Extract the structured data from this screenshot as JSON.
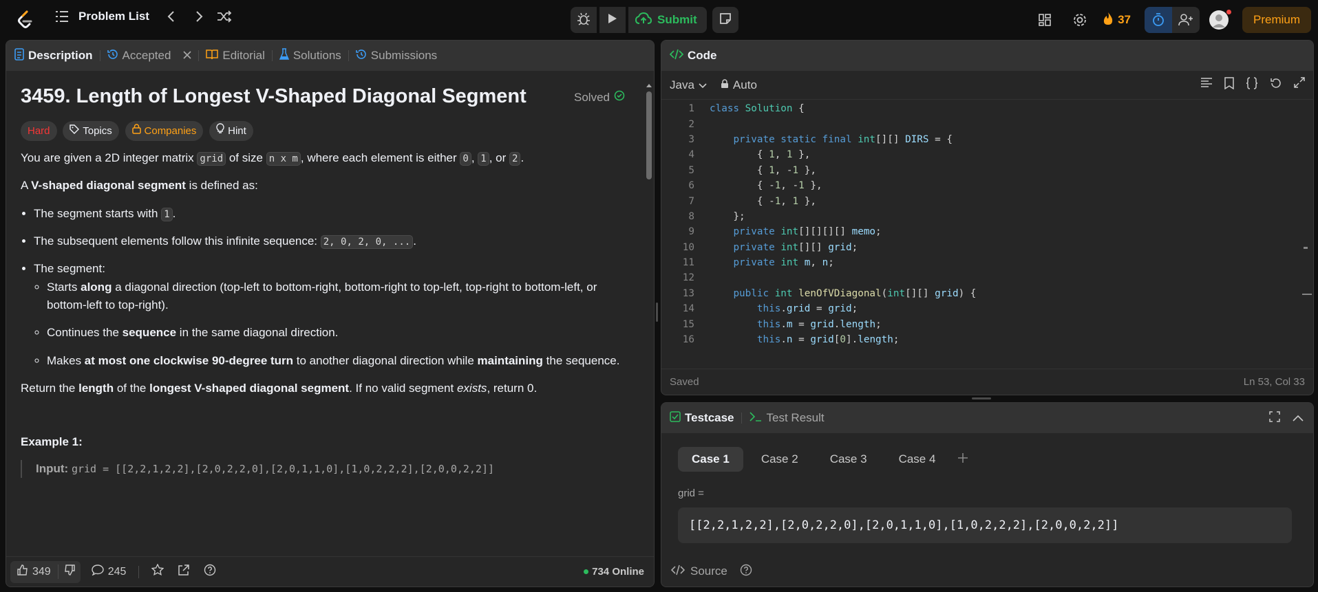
{
  "topbar": {
    "title": "Problem List",
    "submit_label": "Submit",
    "streak": "37",
    "premium_label": "Premium"
  },
  "desc_tabs": [
    {
      "label": "Description"
    },
    {
      "label": "Accepted"
    },
    {
      "label": "Editorial"
    },
    {
      "label": "Solutions"
    },
    {
      "label": "Submissions"
    }
  ],
  "problem": {
    "title": "3459. Length of Longest V-Shaped Diagonal Segment",
    "solved_label": "Solved",
    "difficulty": "Hard",
    "topics_label": "Topics",
    "companies_label": "Companies",
    "hint_label": "Hint",
    "p1_a": "You are given a 2D integer matrix ",
    "p1_code1": "grid",
    "p1_b": " of size ",
    "p1_code2": "n x m",
    "p1_c": ", where each element is either ",
    "p1_code3": "0",
    "p1_d": ", ",
    "p1_code4": "1",
    "p1_e": ", or ",
    "p1_code5": "2",
    "p1_f": ".",
    "p2_a": "A ",
    "p2_b": "V-shaped diagonal segment",
    "p2_c": " is defined as:",
    "li1_a": "The segment starts with ",
    "li1_code": "1",
    "li1_b": ".",
    "li2_a": "The subsequent elements follow this infinite sequence: ",
    "li2_code": "2, 0, 2, 0, ...",
    "li2_b": ".",
    "li3": "The segment:",
    "sub1_a": "Starts ",
    "sub1_b": "along",
    "sub1_c": " a diagonal direction (top-left to bottom-right, bottom-right to top-left, top-right to bottom-left, or bottom-left to top-right).",
    "sub2_a": "Continues the ",
    "sub2_b": "sequence",
    "sub2_c": " in the same diagonal direction.",
    "sub3_a": "Makes ",
    "sub3_b": "at most one clockwise 90-degree turn",
    "sub3_c": " to another diagonal direction while ",
    "sub3_d": "maintaining",
    "sub3_e": " the sequence.",
    "ret_a": "Return the ",
    "ret_b": "length",
    "ret_c": " of the ",
    "ret_d": "longest V-shaped diagonal segment",
    "ret_e": ". If no valid segment ",
    "ret_f": "exists",
    "ret_g": ", return 0.",
    "example_title": "Example 1:",
    "input_label": "Input:",
    "input_value": "grid = [[2,2,1,2,2],[2,0,2,2,0],[2,0,1,1,0],[1,0,2,2,2],[2,0,0,2,2]]"
  },
  "desc_footer": {
    "likes": "349",
    "comments": "245",
    "online": "734 Online"
  },
  "code_panel": {
    "title": "Code",
    "language": "Java",
    "mode": "Auto",
    "status": "Saved",
    "cursor": "Ln 53, Col 33",
    "lines": [
      {
        "n": "1",
        "t": "class Solution {"
      },
      {
        "n": "2",
        "t": ""
      },
      {
        "n": "3",
        "t": "    private static final int[][] DIRS = {"
      },
      {
        "n": "4",
        "t": "        { 1, 1 },"
      },
      {
        "n": "5",
        "t": "        { 1, -1 },"
      },
      {
        "n": "6",
        "t": "        { -1, -1 },"
      },
      {
        "n": "7",
        "t": "        { -1, 1 },"
      },
      {
        "n": "8",
        "t": "    };"
      },
      {
        "n": "9",
        "t": "    private int[][][][] memo;"
      },
      {
        "n": "10",
        "t": "    private int[][] grid;"
      },
      {
        "n": "11",
        "t": "    private int m, n;"
      },
      {
        "n": "12",
        "t": ""
      },
      {
        "n": "13",
        "t": "    public int lenOfVDiagonal(int[][] grid) {"
      },
      {
        "n": "14",
        "t": "        this.grid = grid;"
      },
      {
        "n": "15",
        "t": "        this.m = grid.length;"
      },
      {
        "n": "16",
        "t": "        this.n = grid[0].length;"
      }
    ]
  },
  "testcase_panel": {
    "tab_testcase": "Testcase",
    "tab_result": "Test Result",
    "cases": [
      "Case 1",
      "Case 2",
      "Case 3",
      "Case 4"
    ],
    "var_label": "grid =",
    "var_value": "[[2,2,1,2,2],[2,0,2,2,0],[2,0,1,1,0],[1,0,2,2,2],[2,0,0,2,2]]",
    "source_label": "Source"
  },
  "colors": {
    "accent_green": "#2cbb5d",
    "hard_red": "#f63636",
    "premium_orange": "#ffa116",
    "tab_blue": "#007aff"
  }
}
